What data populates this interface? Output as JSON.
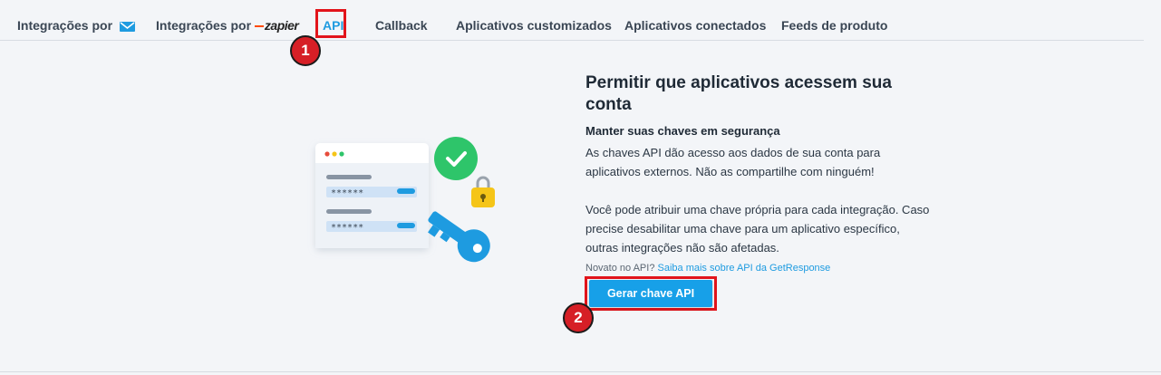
{
  "tabs": [
    {
      "label": "Integrações por",
      "icon": "getresponse-envelope-icon"
    },
    {
      "label": "Integrações por",
      "logo": "zapier"
    },
    {
      "label": "API",
      "active": true
    },
    {
      "label": "Callback"
    },
    {
      "label": "Aplicativos customizados"
    },
    {
      "label": "Aplicativos conectados"
    },
    {
      "label": "Feeds de produto"
    }
  ],
  "markers": {
    "step1": "1",
    "step2": "2"
  },
  "illustration": {
    "masked_key": "******"
  },
  "content": {
    "title": "Permitir que aplicativos acessem sua conta",
    "subtitle": "Manter suas chaves em segurança",
    "para1": "As chaves API dão acesso aos dados de sua conta para aplicativos externos. Não as compartilhe com ninguém!",
    "para2": "Você pode atribuir uma chave própria para cada integração. Caso precise desabilitar uma chave para um aplicativo específico, outras integrações não são afetadas.",
    "note_prefix": "Novato no API?",
    "note_link": "Saiba mais sobre API da GetResponse",
    "button": "Gerar chave API"
  },
  "colors": {
    "accent": "#1e9be0",
    "highlight": "#e2141b",
    "button": "#17a0e8",
    "success": "#2ec56a",
    "lock": "#f5c518"
  }
}
